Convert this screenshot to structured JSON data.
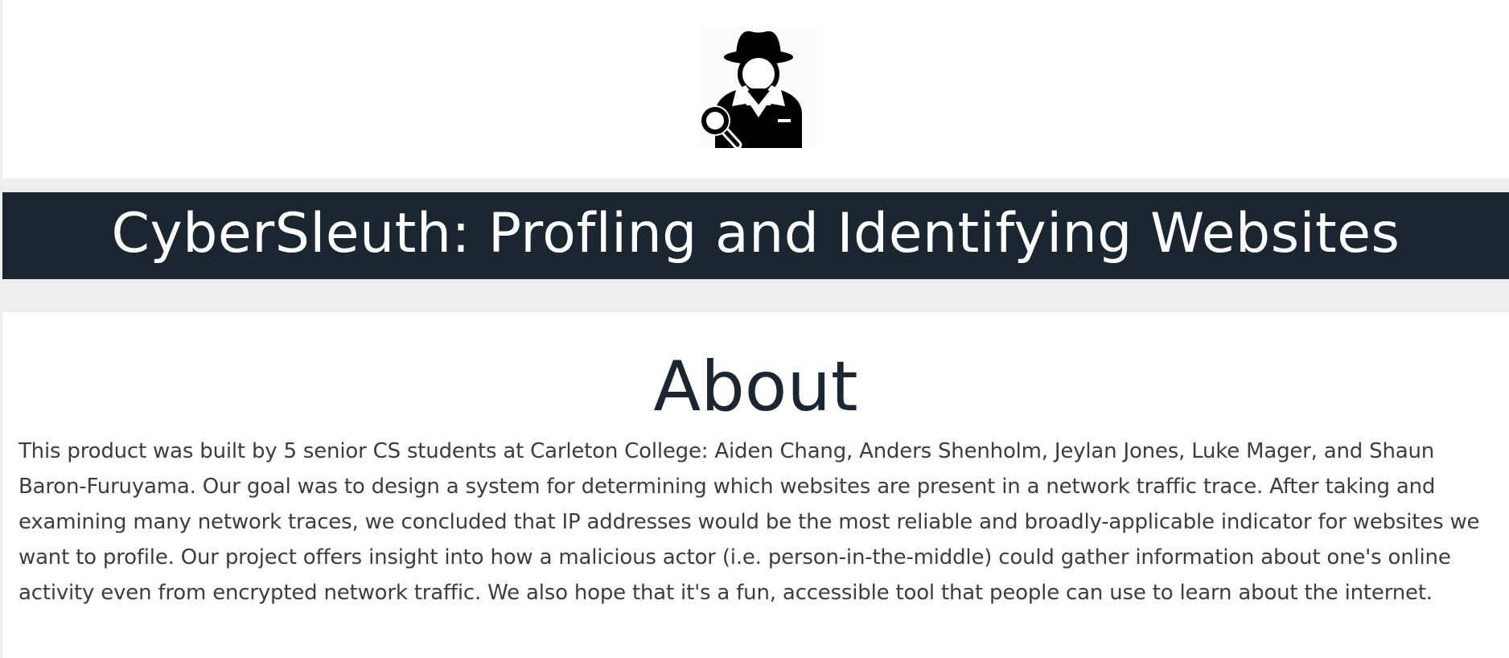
{
  "header": {
    "logo_icon": "detective-magnifier-icon",
    "title": "CyberSleuth: Profling and Identifying Websites"
  },
  "about": {
    "heading": "About",
    "body": "This product was built by 5 senior CS students at Carleton College: Aiden Chang, Anders Shenholm, Jeylan Jones, Luke Mager, and Shaun Baron-Furuyama. Our goal was to design a system for determining which websites are present in a network traffic trace. After taking and examining many network traces, we concluded that IP addresses would be the most reliable and broadly-applicable indicator for websites we want to profile. Our project offers insight into how a malicious actor (i.e. person-in-the-middle) could gather information about one's online activity even from encrypted network traffic. We also hope that it's a fun, accessible tool that people can use to learn about the internet."
  },
  "colors": {
    "page_background": "#eeeeee",
    "panel_background": "#ffffff",
    "title_bar": "#1b2630",
    "title_text": "#ffffff",
    "heading_text": "#1b2630",
    "body_text": "#3d3d3d"
  }
}
